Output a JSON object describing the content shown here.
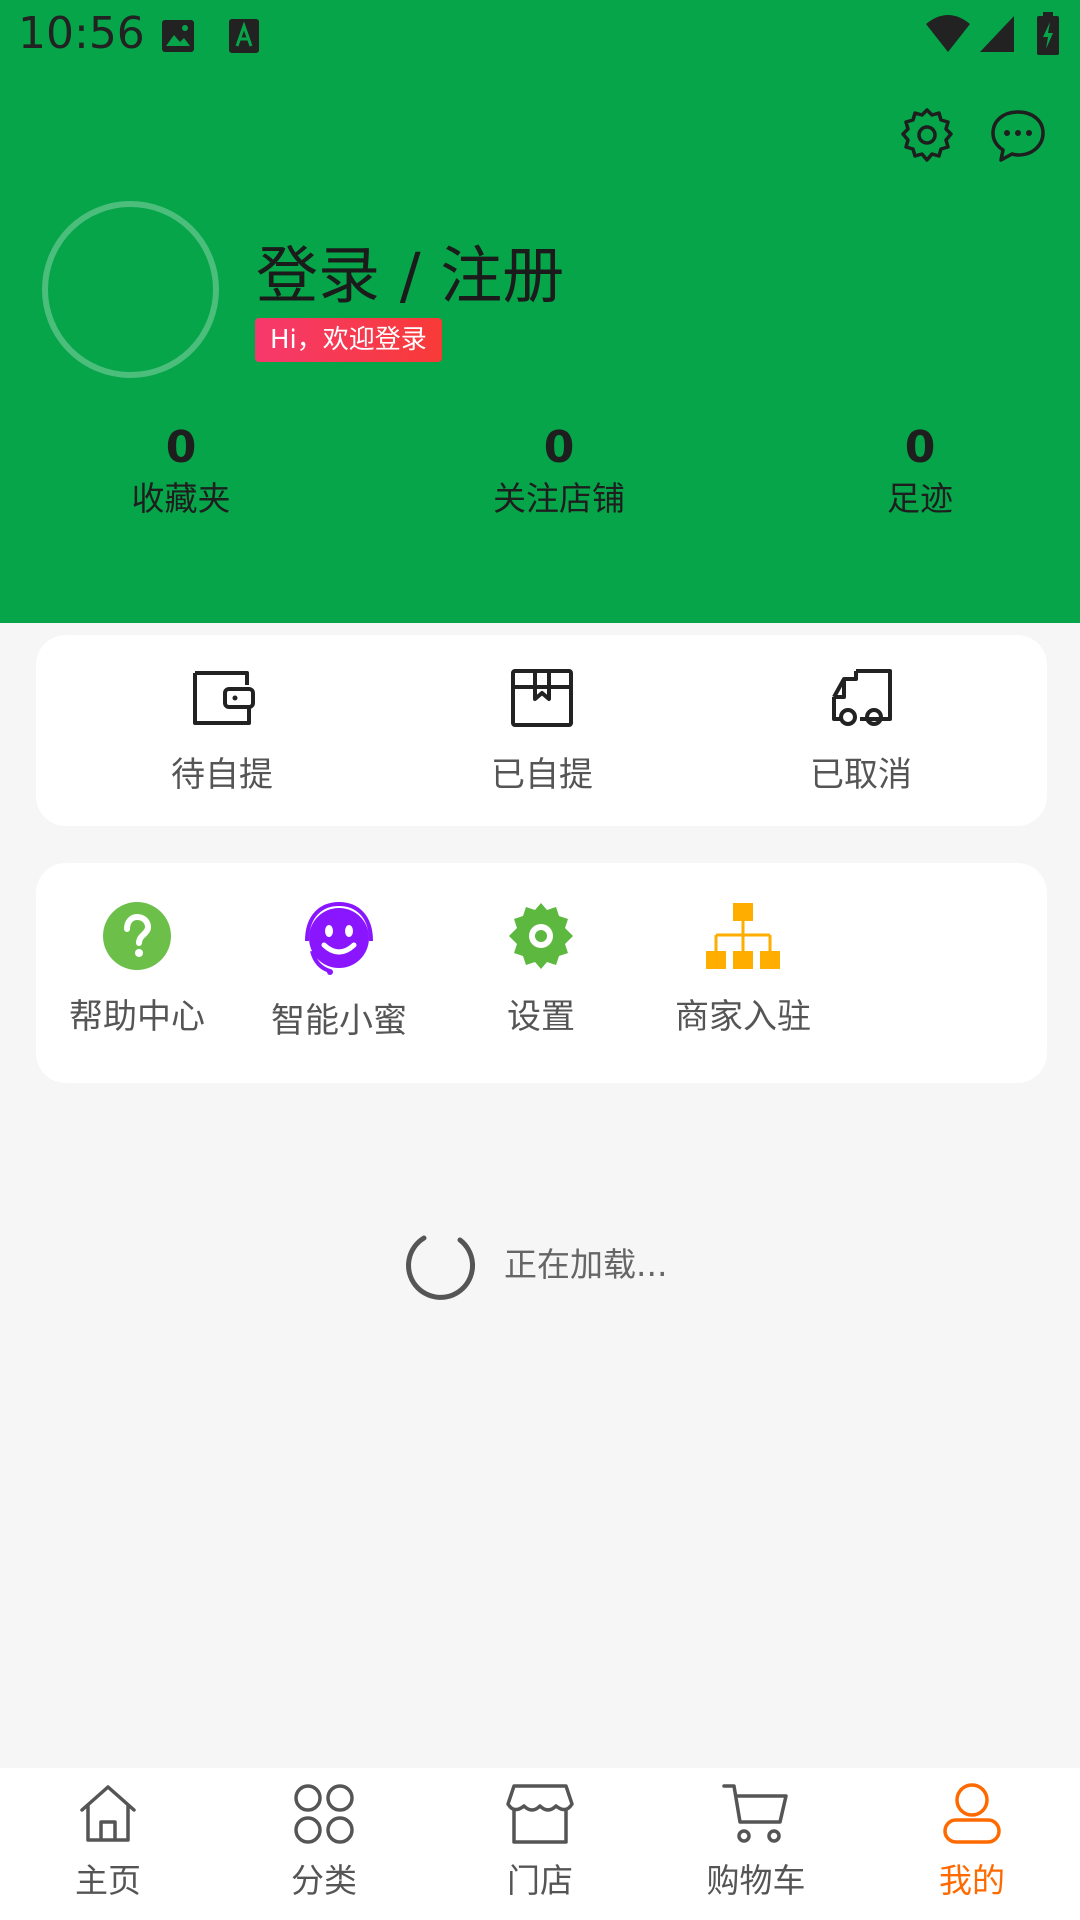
{
  "status_bar": {
    "time": "10:56"
  },
  "header": {
    "settings_icon": "gear-icon",
    "message_icon": "chat-bubble-icon",
    "login_title": "登录 / 注册",
    "welcome_badge": "Hi，欢迎登录",
    "stats": [
      {
        "count": "0",
        "label": "收藏夹"
      },
      {
        "count": "0",
        "label": "关注店铺"
      },
      {
        "count": "0",
        "label": "足迹"
      }
    ]
  },
  "orders": [
    {
      "label": "待自提",
      "icon": "wallet-icon"
    },
    {
      "label": "已自提",
      "icon": "box-icon"
    },
    {
      "label": "已取消",
      "icon": "truck-icon"
    }
  ],
  "tools": [
    {
      "label": "帮助中心",
      "icon": "help-icon",
      "color": "#6cc04a"
    },
    {
      "label": "智能小蜜",
      "icon": "smiley-headset-icon",
      "color": "#8a16ff"
    },
    {
      "label": "设置",
      "icon": "gear-icon",
      "color": "#5cb83e"
    },
    {
      "label": "商家入驻",
      "icon": "org-chart-icon",
      "color": "#ffae00"
    }
  ],
  "loading": {
    "text": "正在加载..."
  },
  "tabbar": {
    "active_color": "#ff6a00",
    "tabs": [
      {
        "label": "主页",
        "icon": "home-icon"
      },
      {
        "label": "分类",
        "icon": "grid-icon"
      },
      {
        "label": "门店",
        "icon": "store-icon"
      },
      {
        "label": "购物车",
        "icon": "cart-icon"
      },
      {
        "label": "我的",
        "icon": "user-icon",
        "active": true
      }
    ]
  },
  "colors": {
    "header_bg": "#06a54a",
    "badge_start": "#f6396c",
    "badge_end": "#f83a37"
  }
}
